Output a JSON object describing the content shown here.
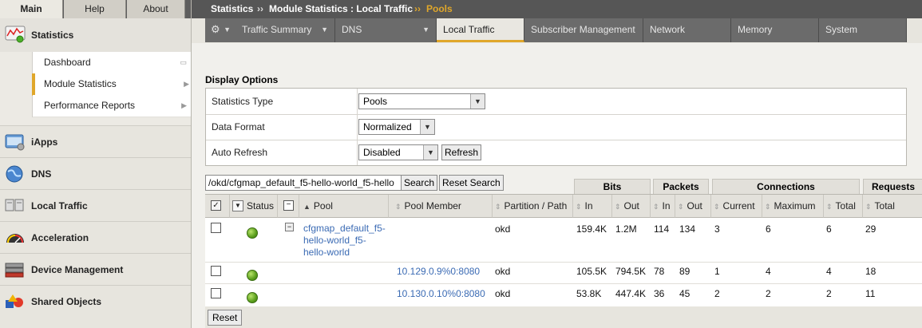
{
  "sidebar": {
    "tabs": [
      "Main",
      "Help",
      "About"
    ],
    "statistics_label": "Statistics",
    "submenu": [
      {
        "label": "Dashboard"
      },
      {
        "label": "Module Statistics"
      },
      {
        "label": "Performance Reports"
      }
    ],
    "nav_items": [
      {
        "label": "iApps",
        "icon": "iapps-icon"
      },
      {
        "label": "DNS",
        "icon": "globe-icon"
      },
      {
        "label": "Local Traffic",
        "icon": "local-traffic-icon"
      },
      {
        "label": "Acceleration",
        "icon": "speedometer-icon"
      },
      {
        "label": "Device Management",
        "icon": "device-icon"
      },
      {
        "label": "Shared Objects",
        "icon": "shapes-icon"
      }
    ]
  },
  "breadcrumb": {
    "part1": "Statistics",
    "sep1": "››",
    "part2": "Module Statistics : Local Traffic",
    "sep2": "››",
    "current": "Pools"
  },
  "menu": {
    "items": [
      "Traffic Summary",
      "DNS",
      "Local Traffic",
      "Subscriber Management",
      "Network",
      "Memory",
      "System"
    ],
    "active": "Local Traffic"
  },
  "display_options": {
    "title": "Display Options",
    "statistics_type": {
      "label": "Statistics Type",
      "value": "Pools"
    },
    "data_format": {
      "label": "Data Format",
      "value": "Normalized"
    },
    "auto_refresh": {
      "label": "Auto Refresh",
      "value": "Disabled",
      "button": "Refresh"
    }
  },
  "search": {
    "value": "/okd/cfgmap_default_f5-hello-world_f5-hello",
    "search_button": "Search",
    "reset_button": "Reset Search"
  },
  "groups": [
    "Bits",
    "Packets",
    "Connections",
    "Requests"
  ],
  "columns": [
    "Status",
    "Pool",
    "Pool Member",
    "Partition / Path",
    "In",
    "Out",
    "In",
    "Out",
    "Current",
    "Maximum",
    "Total",
    "Total"
  ],
  "rows": [
    {
      "pool": "cfgmap_default_f5-hello-world_f5-hello-world",
      "pool_lines": [
        "cfgmap_default_f5-",
        "hello-world_f5-",
        "hello-world"
      ],
      "member": "",
      "partition": "okd",
      "bits_in": "159.4K",
      "bits_out": "1.2M",
      "pkts_in": "114",
      "pkts_out": "134",
      "conn_cur": "3",
      "conn_max": "6",
      "conn_total": "6",
      "req_total": "29"
    },
    {
      "pool": "",
      "pool_lines": [],
      "member": "10.129.0.9%0:8080",
      "partition": "okd",
      "bits_in": "105.5K",
      "bits_out": "794.5K",
      "pkts_in": "78",
      "pkts_out": "89",
      "conn_cur": "1",
      "conn_max": "4",
      "conn_total": "4",
      "req_total": "18"
    },
    {
      "pool": "",
      "pool_lines": [],
      "member": "10.130.0.10%0:8080",
      "partition": "okd",
      "bits_in": "53.8K",
      "bits_out": "447.4K",
      "pkts_in": "36",
      "pkts_out": "45",
      "conn_cur": "2",
      "conn_max": "2",
      "conn_total": "2",
      "req_total": "11"
    }
  ],
  "reset_button": "Reset",
  "colors": {
    "accent": "#e0a72a",
    "link": "#3b6bb4",
    "header_dark": "#565656",
    "status_green": "#5a9e1c"
  }
}
